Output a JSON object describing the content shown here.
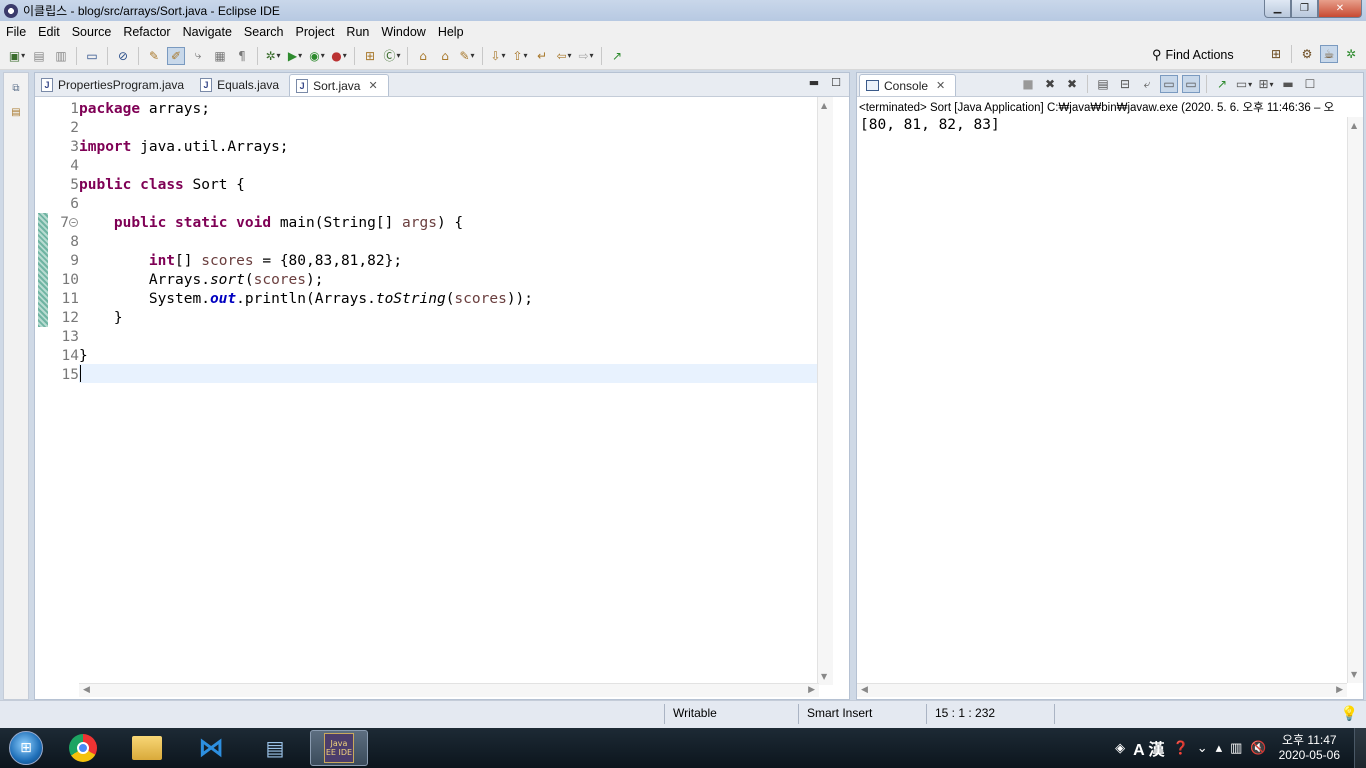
{
  "window": {
    "title": "이클립스 - blog/src/arrays/Sort.java - Eclipse IDE",
    "controls": [
      "minimize",
      "maximize",
      "close"
    ]
  },
  "menu": [
    "File",
    "Edit",
    "Source",
    "Refactor",
    "Navigate",
    "Search",
    "Project",
    "Run",
    "Window",
    "Help"
  ],
  "toolbar": {
    "find_actions": "Find Actions"
  },
  "editor": {
    "tabs": [
      {
        "label": "PropertiesProgram.java",
        "active": false
      },
      {
        "label": "Equals.java",
        "active": false
      },
      {
        "label": "Sort.java",
        "active": true
      }
    ],
    "line_numbers": [
      "1",
      "2",
      "3",
      "4",
      "5",
      "6",
      "7",
      "8",
      "9",
      "10",
      "11",
      "12",
      "13",
      "14",
      "15"
    ],
    "current_line": 15
  },
  "console": {
    "tab_label": "Console",
    "status": "<terminated> Sort [Java Application] C:₩java₩bin₩javaw.exe  (2020. 5. 6. 오후 11:46:36 – 오",
    "output": "[80, 81, 82, 83]"
  },
  "statusbar": {
    "writable": "Writable",
    "insert_mode": "Smart Insert",
    "position": "15 : 1 : 232"
  },
  "taskbar": {
    "apps": [
      "chrome",
      "file-explorer",
      "vscode",
      "media-app",
      "java-ee-ide"
    ],
    "ide_label": "Java EE IDE",
    "ime": "A 漢",
    "clock_time": "오후 11:47",
    "clock_date": "2020-05-06"
  }
}
